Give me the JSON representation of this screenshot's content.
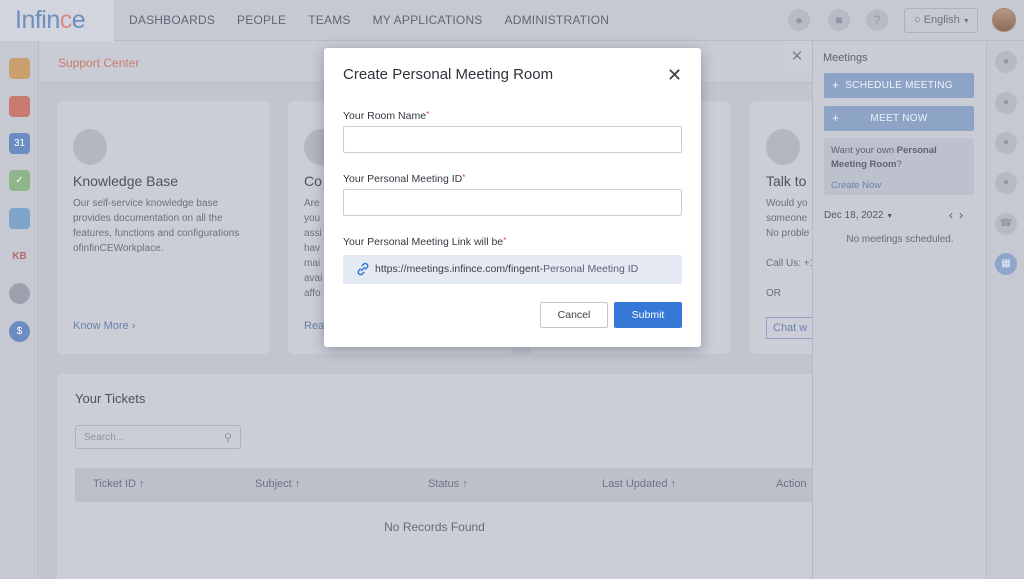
{
  "app": {
    "logo": "Infince"
  },
  "nav": {
    "items": [
      "DASHBOARDS",
      "PEOPLE",
      "TEAMS",
      "MY APPLICATIONS",
      "ADMINISTRATION"
    ],
    "language": "English",
    "icons": [
      "bell-icon",
      "clipboard-icon",
      "help-icon"
    ]
  },
  "left_sidebar": {
    "icons": [
      "folder-icon",
      "mail-icon",
      "calendar-icon",
      "tasks-icon",
      "gallery-icon",
      "kb-icon",
      "chat-bubble-icon",
      "dollar-icon"
    ],
    "calendar_day": "31",
    "kb_label": "KB"
  },
  "breadcrumb": "Support Center",
  "cards": [
    {
      "title": "Knowledge Base",
      "text": "Our self-service knowledge base provides documentation on all the features, functions and configurations ofinfinCEWorkplace.",
      "link": "Know More"
    },
    {
      "title_partial": "Co",
      "text_lines": [
        "Are",
        "you",
        "assi",
        "hav",
        "mai",
        "avai",
        "affo"
      ],
      "link_partial": "Rea"
    },
    {
      "title_partial": "Talk to",
      "text_lines": [
        "Would yo",
        "someone",
        "No proble",
        "",
        "Call Us: +1",
        "",
        "OR"
      ],
      "link_partial": "Chat w"
    }
  ],
  "tickets": {
    "title": "Your Tickets",
    "search_placeholder": "Search...",
    "columns": [
      "Ticket ID ↑",
      "Subject ↑",
      "Status ↑",
      "Last Updated ↑",
      "Action"
    ],
    "empty": "No Records Found"
  },
  "meetings": {
    "title": "Meetings",
    "schedule_label": "SCHEDULE MEETING",
    "meet_now_label": "MEET NOW",
    "promo_prefix": "Want your own ",
    "promo_bold": "Personal Meeting Room",
    "promo_suffix": "?",
    "promo_link": "Create Now",
    "date": "Dec 18, 2022",
    "empty": "No meetings scheduled."
  },
  "right_sidebar": {
    "icons": [
      "chat-icon",
      "contacts-icon",
      "group-icon",
      "team-icon",
      "phone-icon",
      "calendar-icon"
    ]
  },
  "modal": {
    "title": "Create Personal Meeting Room",
    "room_name_label": "Your Room Name",
    "meeting_id_label": "Your Personal Meeting ID",
    "link_label": "Your Personal Meeting Link will be",
    "required_mark": "*",
    "link_base": "https://meetings.infince.com/fingent-",
    "link_placeholder": "Personal Meeting ID",
    "cancel_label": "Cancel",
    "submit_label": "Submit",
    "room_name_value": "",
    "meeting_id_value": ""
  },
  "colors": {
    "accent": "#3578d6",
    "required": "#e0443c",
    "link_box_bg": "#e4e9f4"
  }
}
